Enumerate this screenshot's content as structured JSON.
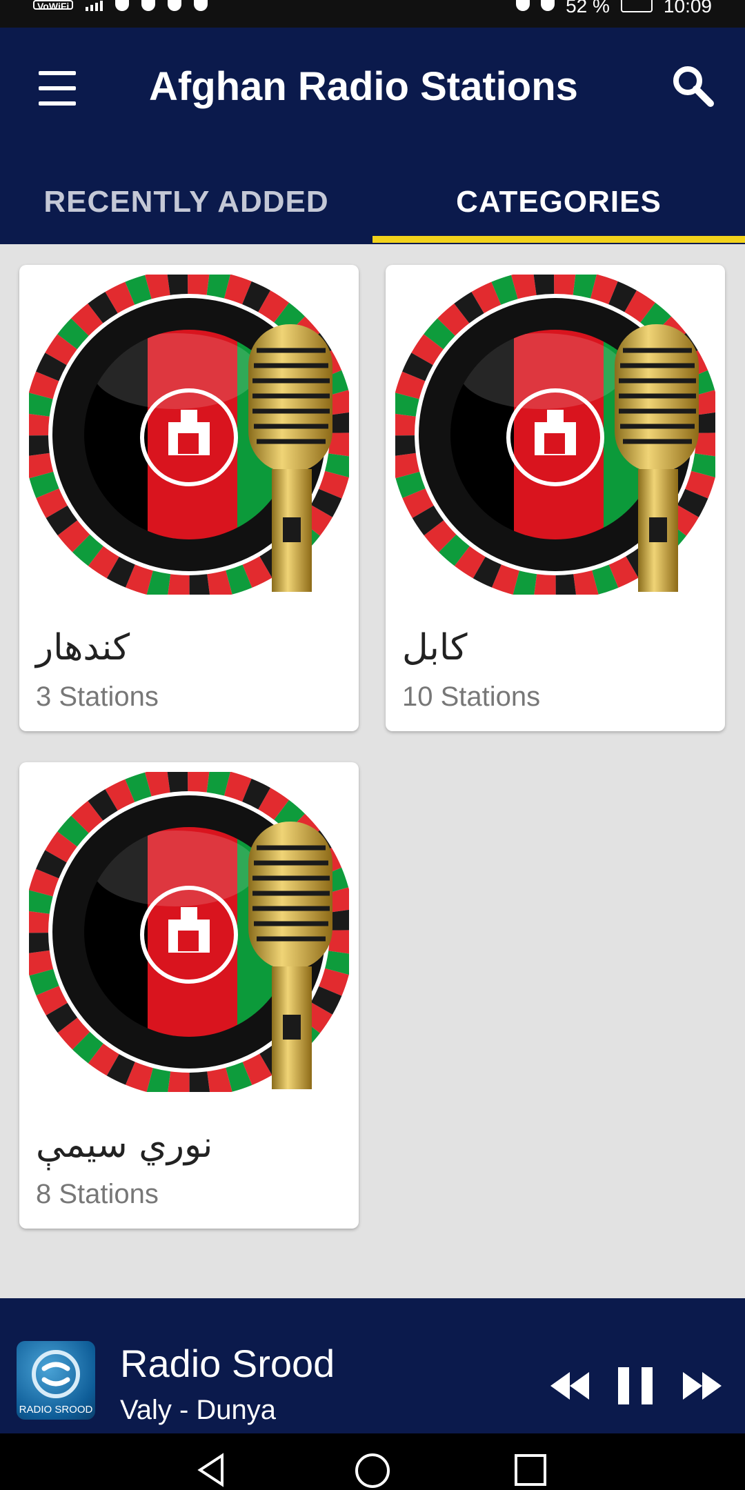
{
  "status_bar": {
    "left_text": "VoWiFi",
    "battery": "52 %",
    "time": "10:09"
  },
  "app_bar": {
    "title": "Afghan Radio Stations",
    "menu_icon": "hamburger-menu-icon",
    "search_icon": "search-icon"
  },
  "tabs": [
    {
      "label": "RECENTLY ADDED",
      "selected": false
    },
    {
      "label": "CATEGORIES",
      "selected": true
    }
  ],
  "categories": [
    {
      "name": "کندهار",
      "count": "3 Stations"
    },
    {
      "name": "کابل",
      "count": "10 Stations"
    },
    {
      "name": "نوري سیمې",
      "count": "8 Stations"
    }
  ],
  "player": {
    "station": "Radio Srood",
    "song": "Valy - Dunya",
    "logo_text": "RADIO SROOD",
    "state": "playing"
  },
  "colors": {
    "primary": "#0b1a4c",
    "accent": "#f2d21b",
    "background": "#e2e2e2"
  }
}
